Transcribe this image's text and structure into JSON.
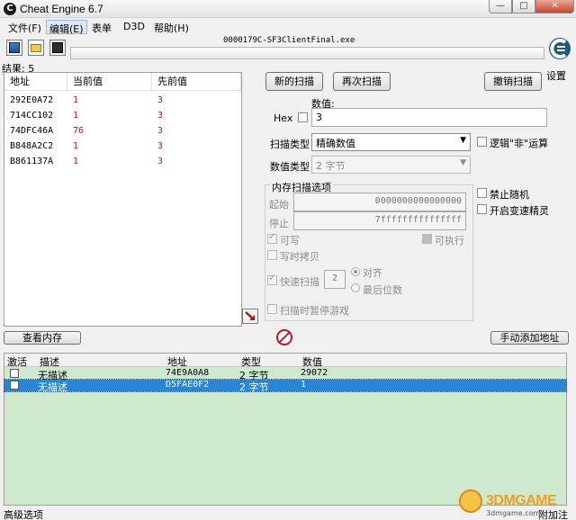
{
  "window": {
    "title": "Cheat Engine 6.7",
    "min": "—",
    "max": "□",
    "close": "✕",
    "app_icon": "C"
  },
  "menu": [
    {
      "label": "文件(F)"
    },
    {
      "label": "编辑(E)"
    },
    {
      "label": "表单"
    },
    {
      "label": "D3D"
    },
    {
      "label": "帮助(H)"
    }
  ],
  "toolbar": {
    "process_name": "0000179C-SF3ClientFinal.exe",
    "settings_label": "设置"
  },
  "results": {
    "label": "结果: 5"
  },
  "address_list": {
    "headers": {
      "address": "地址",
      "current": "当前值",
      "previous": "先前值"
    },
    "rows": [
      {
        "address": "292E0A72",
        "current": "1",
        "previous": "3"
      },
      {
        "address": "714CC102",
        "current": "1",
        "previous": "3"
      },
      {
        "address": "74DFC46A",
        "current": "76",
        "previous": "3"
      },
      {
        "address": "B848A2C2",
        "current": "1",
        "previous": "3"
      },
      {
        "address": "B861137A",
        "current": "1",
        "previous": "3"
      }
    ],
    "value_color": "#d01010"
  },
  "scan": {
    "new_scan": "新的扫描",
    "next_scan": "再次扫描",
    "undo_scan": "撤销扫描",
    "value_label": "数值:",
    "hex_label": "Hex",
    "value": "3",
    "scan_type_label": "扫描类型",
    "scan_type_value": "精确数值",
    "value_type_label": "数值类型",
    "value_type_value": "2 字节",
    "not_logic_label": "逻辑\"非\"运算",
    "disable_random_label": "禁止随机",
    "speedhack_label": "开启变速精灵"
  },
  "memory_options": {
    "title": "内存扫描选项",
    "start_label": "起始",
    "start_value": "0000000000000000",
    "stop_label": "停止",
    "stop_value": "7fffffffffffffff",
    "writable_label": "可写",
    "executable_label": "可执行",
    "copy_on_write_label": "写时拷贝",
    "fast_scan_label": "快速扫描",
    "fast_scan_value": "2",
    "align_label": "对齐",
    "last_digits_label": "最后位数",
    "pause_game_label": "扫描时暂停游戏"
  },
  "bottom": {
    "view_memory": "查看内存",
    "add_address": "手动添加地址",
    "splitter": "....."
  },
  "cheat_table": {
    "headers": {
      "active": "激活",
      "description": "描述",
      "address": "地址",
      "type": "类型",
      "value": "数值"
    },
    "rows": [
      {
        "description": "无描述",
        "address": "74E9A0A8",
        "type": "2 字节",
        "value": "29072"
      },
      {
        "description": "无描述",
        "address": "D5FAE0F2",
        "type": "2 字节",
        "value": "1"
      }
    ],
    "background": "#cfe9cf",
    "selected_color": "#2b84d6"
  },
  "status": {
    "advanced_options": "高级选项",
    "attach_table": "附加注释"
  },
  "watermark": {
    "brand": "3DMGAME",
    "site": "3dmgame.com"
  }
}
